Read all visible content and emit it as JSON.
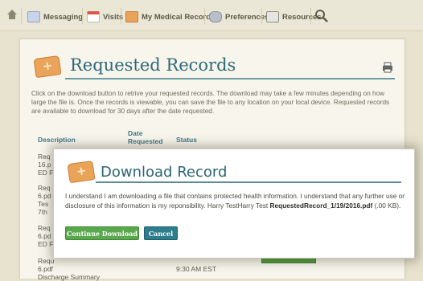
{
  "nav": {
    "items": [
      {
        "label": "Messaging",
        "icon": "envelope-icon",
        "color": "#c8d5e8"
      },
      {
        "label": "Visits",
        "icon": "calendar-icon",
        "color": "#d8584a"
      },
      {
        "label": "My Medical Record",
        "icon": "medical-record-icon",
        "color": "#e9a45a"
      },
      {
        "label": "Preferences",
        "icon": "gears-icon",
        "color": "#b9c0c8"
      },
      {
        "label": "Resources",
        "icon": "book-icon",
        "color": "#d8d8d0"
      }
    ]
  },
  "page": {
    "title": "Requested Records",
    "intro": "Click on the download button to retrive your requested records. The download may take a few minutes depending on how large the file is. Once the records is viewable, you can save the file to any location on your local device. Requested records are available to download for 30 days after the date requested.",
    "table": {
      "headers": [
        "Description",
        "Date Requested",
        "Status"
      ],
      "rows_partial": [
        [
          "Req",
          "16.p",
          "ED F"
        ],
        [
          "Req",
          "6.pd",
          "Tes",
          "7th"
        ],
        [
          "Req",
          "6.pd",
          "ED F"
        ],
        [
          "Requ",
          "6.pdf",
          "Discharge Summary"
        ]
      ],
      "last_row_time": "9:30 AM EST"
    }
  },
  "dialog": {
    "title": "Download Record",
    "body_text": "I understand I am downloading a file that contains protected health information. I understand that any further use or disclosure of this information is my reponsibility. Harry TestHarry Test",
    "file_name": "RequestedRecord_1/19/2016.pdf",
    "file_size": "(.00 KB).",
    "continue_label": "Continue Download",
    "cancel_label": "Cancel"
  },
  "colors": {
    "accent_teal": "#2e6a78",
    "continue_green": "#5aa84c",
    "cancel_teal": "#2e7d8c"
  }
}
